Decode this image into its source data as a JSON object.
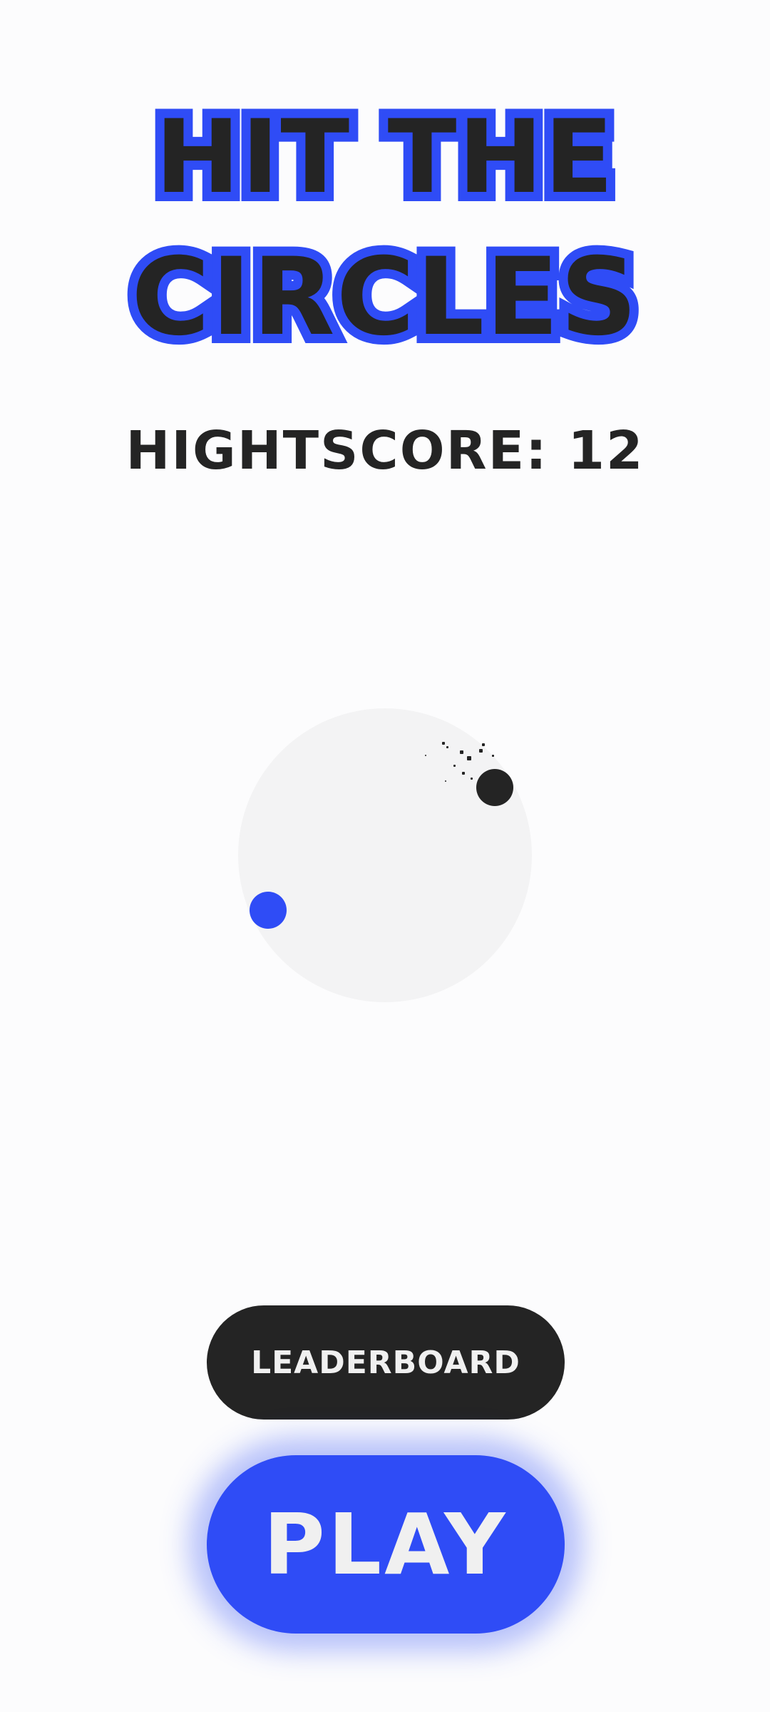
{
  "title": {
    "line1": "HIT THE",
    "line2": "CIRCLES"
  },
  "highscore": {
    "text": "HIGHTSCORE: 12"
  },
  "buttons": {
    "leaderboard_label": "LEADERBOARD",
    "play_label": "PLAY"
  },
  "colors": {
    "accent": "#2f4cf6",
    "dark": "#242424",
    "background": "#fcfcfd",
    "arena": "#f3f3f4",
    "button_text": "#f0f0f0"
  }
}
